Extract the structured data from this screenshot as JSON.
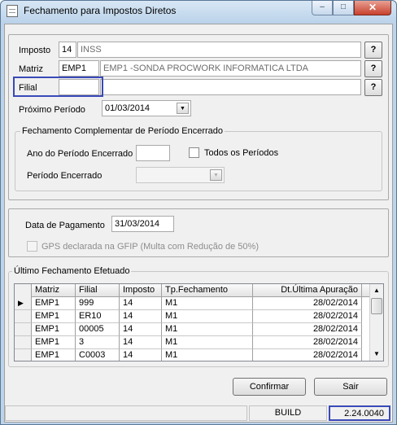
{
  "window": {
    "title": "Fechamento para Impostos Diretos",
    "controls": {
      "minimize": "–",
      "maximize": "□",
      "close": "✕"
    }
  },
  "form": {
    "imposto": {
      "label": "Imposto",
      "code": "14",
      "desc": "INSS",
      "lookup": "?"
    },
    "matriz": {
      "label": "Matriz",
      "code": "EMP1",
      "desc": "EMP1 -SONDA PROCWORK INFORMATICA LTDA",
      "lookup": "?"
    },
    "filial": {
      "label": "Filial",
      "code": "",
      "desc": "",
      "lookup": "?"
    },
    "proximo_periodo": {
      "label": "Próximo Período",
      "value": "01/03/2014"
    }
  },
  "complementar": {
    "title": "Fechamento Complementar de Período Encerrado",
    "ano_label": "Ano do Período Encerrado",
    "ano_value": "",
    "todos_label": "Todos os Períodos",
    "periodo_label": "Período Encerrado",
    "periodo_value": ""
  },
  "pagamento": {
    "label": "Data de Pagamento",
    "value": "31/03/2014",
    "gps_label": "GPS declarada na GFIP (Multa com Redução de 50%)"
  },
  "ultimo": {
    "title": "Último Fechamento Efetuado",
    "columns": [
      "Matriz",
      "Filial",
      "Imposto",
      "Tp.Fechamento",
      "Dt.Última Apuração"
    ],
    "rows": [
      [
        "EMP1",
        "999",
        "14",
        "M1",
        "28/02/2014"
      ],
      [
        "EMP1",
        "ER10",
        "14",
        "M1",
        "28/02/2014"
      ],
      [
        "EMP1",
        "00005",
        "14",
        "M1",
        "28/02/2014"
      ],
      [
        "EMP1",
        "3",
        "14",
        "M1",
        "28/02/2014"
      ],
      [
        "EMP1",
        "C0003",
        "14",
        "M1",
        "28/02/2014"
      ]
    ]
  },
  "buttons": {
    "confirmar": "Confirmar",
    "sair": "Sair"
  },
  "status": {
    "build_label": "BUILD",
    "version": "2.24.0040"
  }
}
